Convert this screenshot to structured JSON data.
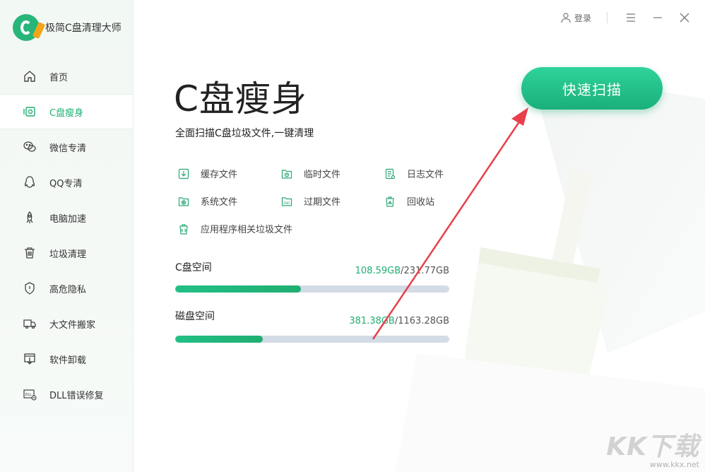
{
  "app": {
    "name": "极简C盘清理大师"
  },
  "sidebar": {
    "items": [
      {
        "label": "首页",
        "icon": "home-icon"
      },
      {
        "label": "C盘瘦身",
        "icon": "disk-icon",
        "active": true
      },
      {
        "label": "微信专清",
        "icon": "wechat-icon"
      },
      {
        "label": "QQ专清",
        "icon": "qq-icon"
      },
      {
        "label": "电脑加速",
        "icon": "rocket-icon"
      },
      {
        "label": "垃圾清理",
        "icon": "trash-icon"
      },
      {
        "label": "高危隐私",
        "icon": "shield-icon"
      },
      {
        "label": "大文件搬家",
        "icon": "truck-icon"
      },
      {
        "label": "软件卸载",
        "icon": "uninstall-icon"
      },
      {
        "label": "DLL错误修复",
        "icon": "dll-icon"
      }
    ]
  },
  "topbar": {
    "login_label": "登录"
  },
  "main": {
    "title": "C盘瘦身",
    "subtitle": "全面扫描C盘垃圾文件,一键清理",
    "categories": [
      {
        "label": "缓存文件",
        "icon": "cache-icon"
      },
      {
        "label": "临时文件",
        "icon": "temp-icon"
      },
      {
        "label": "日志文件",
        "icon": "log-icon"
      },
      {
        "label": "系统文件",
        "icon": "system-icon"
      },
      {
        "label": "过期文件",
        "icon": "expired-icon"
      },
      {
        "label": "回收站",
        "icon": "recycle-icon"
      },
      {
        "label": "应用程序相关垃圾文件",
        "icon": "app-junk-icon"
      }
    ],
    "scan_button": "快速扫描",
    "c_space": {
      "label": "C盘空间",
      "used": "108.59GB",
      "total": "231.77GB",
      "used_fraction": 0.46
    },
    "disk_space": {
      "label": "磁盘空间",
      "used": "381.38GB",
      "total": "1163.28GB",
      "used_fraction": 0.32
    }
  },
  "watermark": {
    "text": "KK下载",
    "url": "www.kkx.net"
  },
  "colors": {
    "accent": "#1fae72",
    "bar_bg": "#d3dbe6",
    "arrow": "#e8404a"
  }
}
